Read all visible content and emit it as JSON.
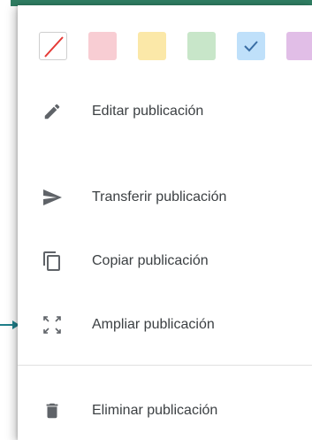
{
  "swatches": [
    {
      "name": "none",
      "color": "#ffffff",
      "border": "#cfcfcf",
      "icon": "no-color-slash-icon",
      "selected": false
    },
    {
      "name": "red",
      "color": "#f8cdd3",
      "border": "#f8cdd3",
      "selected": false
    },
    {
      "name": "yellow",
      "color": "#fbe8a8",
      "border": "#fbe8a8",
      "selected": false
    },
    {
      "name": "green",
      "color": "#c8e6c9",
      "border": "#c8e6c9",
      "selected": false
    },
    {
      "name": "blue",
      "color": "#bfe0fa",
      "border": "#bfe0fa",
      "icon": "checkmark-icon",
      "selected": true
    },
    {
      "name": "purple",
      "color": "#e1bee7",
      "border": "#e1bee7",
      "selected": false
    }
  ],
  "menu": {
    "edit_label": "Editar publicación",
    "transfer_label": "Transferir publicación",
    "copy_label": "Copiar publicación",
    "expand_label": "Ampliar publicación",
    "delete_label": "Eliminar publicación"
  },
  "colors": {
    "accent_strip": "#2f7d62",
    "icon": "#5f6368",
    "text": "#3c4043",
    "pointer": "#1f7f8a",
    "slash": "#e53935",
    "check": "#3a6ea5"
  }
}
